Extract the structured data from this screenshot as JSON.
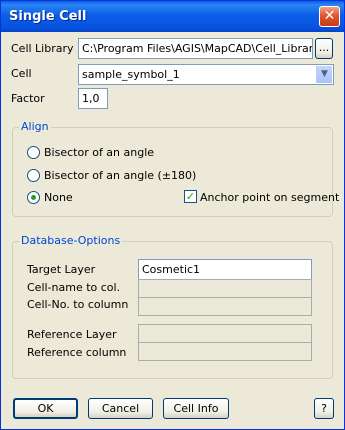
{
  "window": {
    "title": "Single Cell",
    "close_label": "✕"
  },
  "cell_library": {
    "label": "Cell Library",
    "value": "C:\\Program Files\\AGIS\\MapCAD\\Cell_Library.T",
    "browse_label": "..."
  },
  "cell": {
    "label": "Cell",
    "value": "sample_symbol_1"
  },
  "factor": {
    "label": "Factor",
    "value": "1,0"
  },
  "align": {
    "title": "Align",
    "options": [
      {
        "label": "Bisector of an angle",
        "checked": false
      },
      {
        "label": "Bisector of an angle (±180)",
        "checked": false
      },
      {
        "label": "None",
        "checked": true
      }
    ],
    "anchor_checkbox": {
      "label": "Anchor point on segment",
      "checked": true
    }
  },
  "database": {
    "title": "Database-Options",
    "target_layer": {
      "label": "Target Layer",
      "value": "Cosmetic1"
    },
    "cell_name": {
      "label": "Cell-name to col.",
      "value": ""
    },
    "cell_no": {
      "label": "Cell-No. to column",
      "value": ""
    },
    "reference_layer": {
      "label": "Reference Layer",
      "value": ""
    },
    "reference_column": {
      "label": "Reference column",
      "value": ""
    }
  },
  "buttons": {
    "ok": "OK",
    "cancel": "Cancel",
    "cell_info": "Cell Info",
    "help": "?"
  }
}
